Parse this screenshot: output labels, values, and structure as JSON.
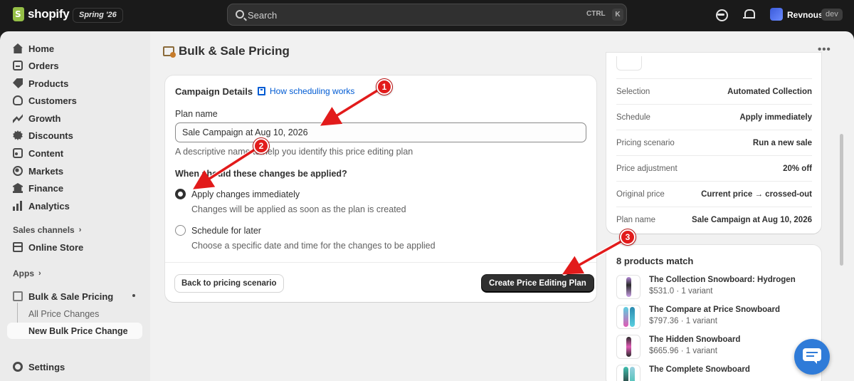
{
  "topbar": {
    "brand": "shopify",
    "season": "Spring '26",
    "search_placeholder": "Search",
    "shortcut_ctrl": "CTRL",
    "shortcut_key": "K",
    "store_name": "Revnous",
    "store_badge": "dev"
  },
  "sidebar": {
    "items": [
      {
        "label": "Home",
        "icon": "home-icon"
      },
      {
        "label": "Orders",
        "icon": "orders-icon"
      },
      {
        "label": "Products",
        "icon": "tag-icon"
      },
      {
        "label": "Customers",
        "icon": "person-icon"
      },
      {
        "label": "Growth",
        "icon": "growth-icon"
      },
      {
        "label": "Discounts",
        "icon": "discount-icon"
      },
      {
        "label": "Content",
        "icon": "content-icon"
      },
      {
        "label": "Markets",
        "icon": "globe-icon"
      },
      {
        "label": "Finance",
        "icon": "bank-icon"
      },
      {
        "label": "Analytics",
        "icon": "bar-chart-icon"
      }
    ],
    "sales_channels_label": "Sales channels",
    "online_store_label": "Online Store",
    "apps_label": "Apps",
    "app_name": "Bulk & Sale Pricing",
    "app_sub_items": [
      "All Price Changes",
      "New Bulk Price Change"
    ],
    "settings_label": "Settings"
  },
  "page": {
    "title": "Bulk & Sale Pricing",
    "more": "•••"
  },
  "campaign": {
    "title": "Campaign Details",
    "help_link": "How scheduling works",
    "plan_name_label": "Plan name",
    "plan_name_value": "Sale Campaign at Aug 10, 2026",
    "plan_name_help": "A descriptive name to help you identify this price editing plan",
    "question": "When should these changes be applied?",
    "options": [
      {
        "label": "Apply changes immediately",
        "help": "Changes will be applied as soon as the plan is created",
        "checked": true
      },
      {
        "label": "Schedule for later",
        "help": "Choose a specific date and time for the changes to be applied",
        "checked": false
      }
    ],
    "back_button": "Back to pricing scenario",
    "create_button": "Create Price Editing Plan"
  },
  "summary": {
    "rows": [
      {
        "key": "Selection",
        "value": "Automated Collection"
      },
      {
        "key": "Schedule",
        "value": "Apply immediately"
      },
      {
        "key": "Pricing scenario",
        "value": "Run a new sale"
      },
      {
        "key": "Price adjustment",
        "value": "20% off"
      },
      {
        "key": "Original price",
        "value": "Current price → crossed-out"
      },
      {
        "key": "Plan name",
        "value": "Sale Campaign at Aug 10, 2026"
      }
    ]
  },
  "products": {
    "title": "8 products match",
    "items": [
      {
        "name": "The Collection Snowboard: Hydrogen",
        "meta": "$531.0 · 1 variant"
      },
      {
        "name": "The Compare at Price Snowboard",
        "meta": "$797.36 · 1 variant"
      },
      {
        "name": "The Hidden Snowboard",
        "meta": "$665.96 · 1 variant"
      },
      {
        "name": "The Complete Snowboard",
        "meta": ""
      }
    ]
  },
  "annotations": [
    "1",
    "2",
    "3"
  ],
  "colors": {
    "primary_button": "#303030",
    "link": "#005bd3",
    "annotation": "#e21b1b",
    "brand_green": "#95bf47",
    "chat": "#2f7bd8"
  }
}
